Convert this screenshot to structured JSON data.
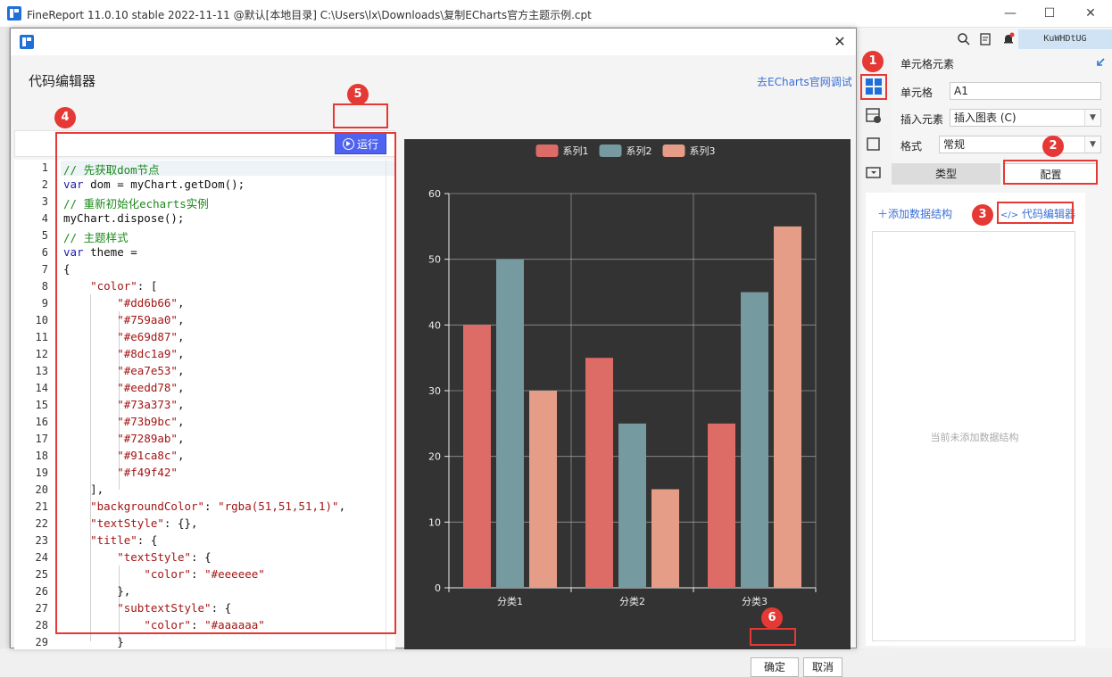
{
  "window": {
    "title": "FineReport 11.0.10 stable 2022-11-11 @默认[本地目录]    C:\\Users\\lx\\Downloads\\复制ECharts官方主题示例.cpt",
    "minimize": "—",
    "maximize": "☐",
    "close": "✕"
  },
  "right_panel": {
    "user_badge": "KuWHDtUG",
    "header": "单元格元素",
    "cell_label": "单元格",
    "cell_value": "A1",
    "insert_label": "插入元素",
    "insert_value": "插入图表 (C)",
    "format_label": "格式",
    "format_value": "常规",
    "tab_type": "类型",
    "tab_config": "配置",
    "add_data_structure": "添加数据结构",
    "code_editor_link": "代码编辑器",
    "empty_hint": "当前未添加数据结构"
  },
  "dialog": {
    "title": "代码编辑器",
    "echarts_link": "去ECharts官网调试",
    "run_label": "运行",
    "ok_label": "确定",
    "cancel_label": "取消"
  },
  "markers": [
    "1",
    "2",
    "3",
    "4",
    "5",
    "6"
  ],
  "code_lines": [
    "// 先获取dom节点",
    "var dom = myChart.getDom();",
    "// 重新初始化echarts实例",
    "myChart.dispose();",
    "// 主题样式",
    "var theme =",
    "{",
    "    \"color\": [",
    "        \"#dd6b66\",",
    "        \"#759aa0\",",
    "        \"#e69d87\",",
    "        \"#8dc1a9\",",
    "        \"#ea7e53\",",
    "        \"#eedd78\",",
    "        \"#73a373\",",
    "        \"#73b9bc\",",
    "        \"#7289ab\",",
    "        \"#91ca8c\",",
    "        \"#f49f42\"",
    "    ],",
    "    \"backgroundColor\": \"rgba(51,51,51,1)\",",
    "    \"textStyle\": {},",
    "    \"title\": {",
    "        \"textStyle\": {",
    "            \"color\": \"#eeeeee\"",
    "        },",
    "        \"subtextStyle\": {",
    "            \"color\": \"#aaaaaa\"",
    "        }"
  ],
  "chart_data": {
    "type": "bar",
    "categories": [
      "分类1",
      "分类2",
      "分类3"
    ],
    "series": [
      {
        "name": "系列1",
        "values": [
          40,
          35,
          25
        ],
        "color": "#dd6b66"
      },
      {
        "name": "系列2",
        "values": [
          50,
          25,
          45
        ],
        "color": "#759aa0"
      },
      {
        "name": "系列3",
        "values": [
          30,
          15,
          55
        ],
        "color": "#e69d87"
      }
    ],
    "yticks": [
      "0",
      "10",
      "20",
      "30",
      "40",
      "50",
      "60"
    ],
    "ylim": [
      0,
      60
    ],
    "grid": true,
    "legend": "top-center",
    "background": "#333333"
  }
}
